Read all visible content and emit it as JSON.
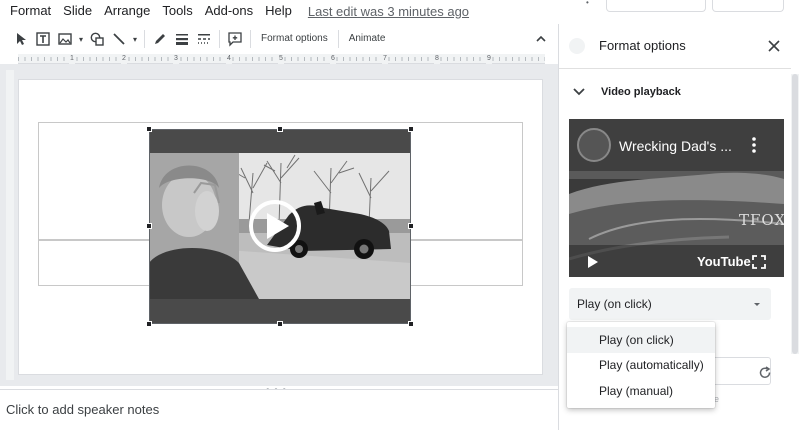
{
  "menu": {
    "items": [
      "Format",
      "Slide",
      "Arrange",
      "Tools",
      "Add-ons",
      "Help"
    ],
    "last_edit": "Last edit was 3 minutes ago"
  },
  "toolbar": {
    "format_options": "Format options",
    "animate": "Animate",
    "icons": [
      "select-icon",
      "textbox-icon",
      "image-icon",
      "shape-icon",
      "line-icon",
      "pen-icon",
      "border-weight-icon",
      "border-dash-icon",
      "comment-icon"
    ]
  },
  "ruler": {
    "numbers": [
      "1",
      "2",
      "3",
      "4",
      "5",
      "6",
      "7",
      "8",
      "9"
    ]
  },
  "notes": {
    "placeholder": "Click to add speaker notes"
  },
  "panel": {
    "title": "Format options",
    "section": "Video playback",
    "video_title": "Wrecking Dad's ...",
    "youtube_label": "YouTube",
    "watermark": "TFOX",
    "play_mode": "Play (on click)",
    "faint_text": "t time"
  },
  "dropdown": {
    "options": [
      "Play (on click)",
      "Play (automatically)",
      "Play (manual)"
    ],
    "selected_index": 0
  },
  "colors": {
    "toolbar_icon": "#3c4043",
    "selected_bg": "#f1f3f4",
    "canvas_bg": "#e8eaed"
  }
}
